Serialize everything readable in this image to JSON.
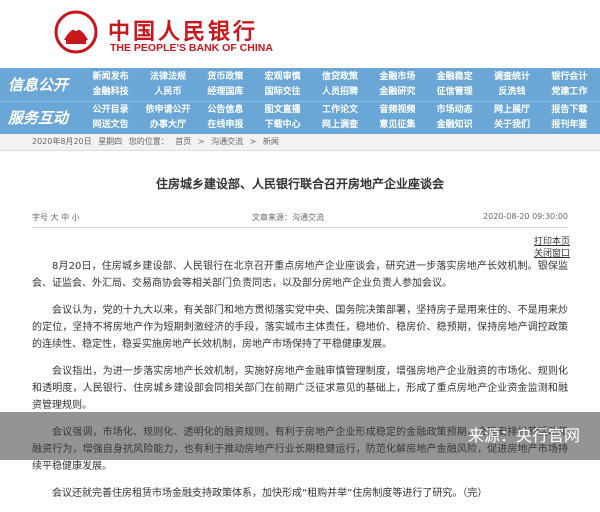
{
  "header": {
    "logo_cn": "中国人民银行",
    "logo_en": "THE PEOPLE'S BANK OF CHINA",
    "brand_color": "#c8161d"
  },
  "nav": {
    "color": "#6aa6d6",
    "info_title": "信息公开",
    "info_items": [
      "新闻发布",
      "法律法规",
      "货币政策",
      "宏观审慎",
      "信贷政策",
      "金融市场",
      "金融稳定",
      "调查统计",
      "银行会计",
      "支付体系",
      "金融科技",
      "人民币",
      "经理国库",
      "国际交往",
      "人员招聘",
      "金融研究",
      "征信管理",
      "反洗钱",
      "党建工作",
      "工会工作"
    ],
    "service_title": "服务互动",
    "service_items": [
      "公开目录",
      "依申请公开",
      "公告信息",
      "图文直播",
      "工作论文",
      "音频视频",
      "市场动态",
      "网上展厅",
      "报告下载",
      "报刊年鉴",
      "网送文告",
      "办事大厅",
      "在线申报",
      "下载中心",
      "网上调查",
      "意见征集",
      "金融知识",
      "关于我们"
    ]
  },
  "breadcrumb": {
    "date_label": "2020年8月20日",
    "weekday": "星期四",
    "location_label": "您的位置：",
    "home": "首页",
    "section": "沟通交流",
    "current": "新闻"
  },
  "article": {
    "title": "住房城乡建设部、人民银行联合召开房地产企业座谈会",
    "font_label": "字号",
    "font_large": "大",
    "font_medium": "中",
    "font_small": "小",
    "source": "文章来源：沟通交流",
    "date": "2020-08-20 09:30:00",
    "print": "打印本页",
    "close": "关闭窗口",
    "paragraphs": [
      "8月20日，住房城乡建设部、人民银行在北京召开重点房地产企业座谈会，研究进一步落实房地产长效机制。银保监会、证监会、外汇局、交易商协会等相关部门负责同志，以及部分房地产企业负责人参加会议。",
      "会议认为，党的十九大以来，有关部门和地方贯彻落实党中央、国务院决策部署，坚持房子是用来住的、不是用来炒的定位，坚持不将房地产作为短期刺激经济的手段，落实城市主体责任，稳地价、稳房价、稳预期，保持房地产调控政策的连续性、稳定性，稳妥实施房地产长效机制，房地产市场保持了平稳健康发展。",
      "会议指出，为进一步落实房地产长效机制，实施好房地产金融审慎管理制度，增强房地产企业融资的市场化、规则化和透明度，人民银行、住房城乡建设部会同相关部门在前期广泛征求意见的基础上，形成了重点房地产企业资金监测和融资管理规则。",
      "会议强调，市场化、规则化、透明化的融资规则，有利于房地产企业形成稳定的金融政策预期，合理安排经营活动和融资行为，增强自身抗风险能力，也有利于推动房地产行业长期稳健运行，防范化解房地产金融风险，促进房地产市场持续平稳健康发展。",
      "会议还就完善住房租赁市场金融支持政策体系，加快形成“租购并举”住房制度等进行了研究。（完）"
    ]
  },
  "watermark": "来源：央行官网"
}
